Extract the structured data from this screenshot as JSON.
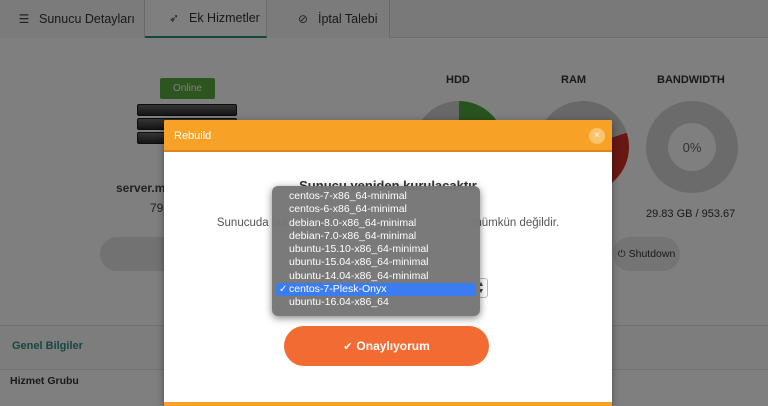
{
  "tabs": [
    {
      "label": "Sunucu Detayları",
      "icon": "server-list-icon"
    },
    {
      "label": "Ek Hizmetler",
      "icon": "rocket-icon"
    },
    {
      "label": "İptal Talebi",
      "icon": "ban-icon"
    }
  ],
  "server": {
    "status": "Online",
    "name": "server.m",
    "ip_partial": "79"
  },
  "metrics": {
    "hdd_title": "HDD",
    "ram_title": "RAM",
    "bandwidth_title": "BANDWIDTH",
    "bandwidth_percent": "0%",
    "bandwidth_usage": "29.83 GB / 953.67"
  },
  "actions": {
    "shutdown_label": "Shutdown"
  },
  "info": {
    "section_title": "Genel Bilgiler",
    "service_group_label": "Hizmet Grubu"
  },
  "modal": {
    "title": "Rebuild",
    "close_icon": "×",
    "heading": "Sunucu yeniden kurulacaktır",
    "text_left": "Sunucuda bul",
    "text_right": "mümkün değildir.",
    "confirm_label": "Onaylıyorum",
    "confirm_icon": "✔"
  },
  "os_select": {
    "selected": "centos-7-Plesk-Onyx",
    "options": [
      "centos-7-x86_64-minimal",
      "centos-6-x86_64-minimal",
      "debian-8.0-x86_64-minimal",
      "debian-7.0-x86_64-minimal",
      "ubuntu-15.10-x86_64-minimal",
      "ubuntu-15.04-x86_64-minimal",
      "ubuntu-14.04-x86_64-minimal",
      "centos-7-Plesk-Onyx",
      "ubuntu-16.04-x86_64"
    ]
  },
  "colors": {
    "accent_teal": "#2a8f83",
    "modal_orange": "#f7a227",
    "button_orange": "#f26b33",
    "online_green": "#5aaa3f",
    "hdd_green": "#52a73d",
    "ram_red": "#d22f27",
    "select_blue": "#3b7df0"
  }
}
